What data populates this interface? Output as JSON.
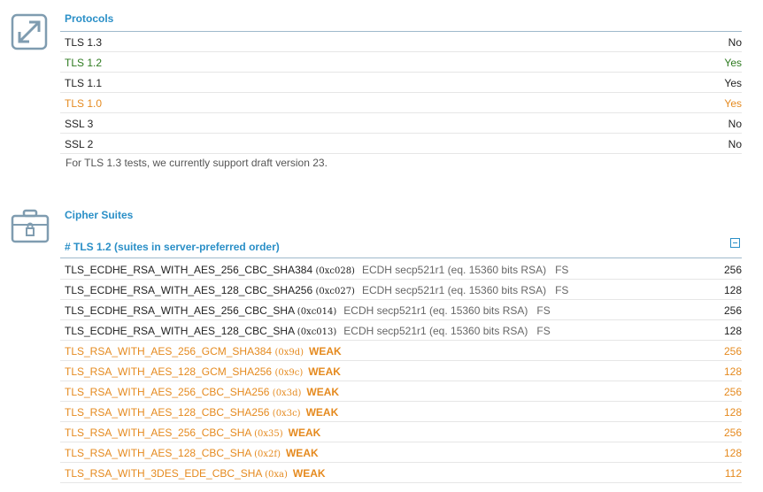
{
  "protocols": {
    "title": "Protocols",
    "rows": [
      {
        "name": "TLS 1.3",
        "value": "No",
        "tone": ""
      },
      {
        "name": "TLS 1.2",
        "value": "Yes",
        "tone": "green"
      },
      {
        "name": "TLS 1.1",
        "value": "Yes",
        "tone": ""
      },
      {
        "name": "TLS 1.0",
        "value": "Yes",
        "tone": "orange"
      },
      {
        "name": "SSL 3",
        "value": "No",
        "tone": ""
      },
      {
        "name": "SSL 2",
        "value": "No",
        "tone": ""
      }
    ],
    "note": "For TLS 1.3 tests, we currently support draft version 23."
  },
  "cipher": {
    "title": "Cipher Suites",
    "group_title": "# TLS 1.2 (suites in server-preferred order)",
    "suites": [
      {
        "name": "TLS_ECDHE_RSA_WITH_AES_256_CBC_SHA384",
        "code": "(0xc028)",
        "kx": "ECDH secp521r1 (eq. 15360 bits RSA)   FS",
        "weak": "",
        "bits": "256",
        "tone": ""
      },
      {
        "name": "TLS_ECDHE_RSA_WITH_AES_128_CBC_SHA256",
        "code": "(0xc027)",
        "kx": "ECDH secp521r1 (eq. 15360 bits RSA)   FS",
        "weak": "",
        "bits": "128",
        "tone": ""
      },
      {
        "name": "TLS_ECDHE_RSA_WITH_AES_256_CBC_SHA",
        "code": "(0xc014)",
        "kx": "ECDH secp521r1 (eq. 15360 bits RSA)   FS",
        "weak": "",
        "bits": "256",
        "tone": ""
      },
      {
        "name": "TLS_ECDHE_RSA_WITH_AES_128_CBC_SHA",
        "code": "(0xc013)",
        "kx": "ECDH secp521r1 (eq. 15360 bits RSA)   FS",
        "weak": "",
        "bits": "128",
        "tone": ""
      },
      {
        "name": "TLS_RSA_WITH_AES_256_GCM_SHA384",
        "code": "(0x9d)",
        "kx": "",
        "weak": "WEAK",
        "bits": "256",
        "tone": "orange"
      },
      {
        "name": "TLS_RSA_WITH_AES_128_GCM_SHA256",
        "code": "(0x9c)",
        "kx": "",
        "weak": "WEAK",
        "bits": "128",
        "tone": "orange"
      },
      {
        "name": "TLS_RSA_WITH_AES_256_CBC_SHA256",
        "code": "(0x3d)",
        "kx": "",
        "weak": "WEAK",
        "bits": "256",
        "tone": "orange"
      },
      {
        "name": "TLS_RSA_WITH_AES_128_CBC_SHA256",
        "code": "(0x3c)",
        "kx": "",
        "weak": "WEAK",
        "bits": "128",
        "tone": "orange"
      },
      {
        "name": "TLS_RSA_WITH_AES_256_CBC_SHA",
        "code": "(0x35)",
        "kx": "",
        "weak": "WEAK",
        "bits": "256",
        "tone": "orange"
      },
      {
        "name": "TLS_RSA_WITH_AES_128_CBC_SHA",
        "code": "(0x2f)",
        "kx": "",
        "weak": "WEAK",
        "bits": "128",
        "tone": "orange"
      },
      {
        "name": "TLS_RSA_WITH_3DES_EDE_CBC_SHA",
        "code": "(0xa)",
        "kx": "",
        "weak": "WEAK",
        "bits": "112",
        "tone": "orange"
      }
    ]
  },
  "icons": {
    "protocols": "expand-arrows-icon",
    "cipher": "briefcase-lock-icon"
  },
  "colors": {
    "accent": "#2a8fc7",
    "good": "#2d7a1f",
    "warn": "#e58a1f"
  }
}
